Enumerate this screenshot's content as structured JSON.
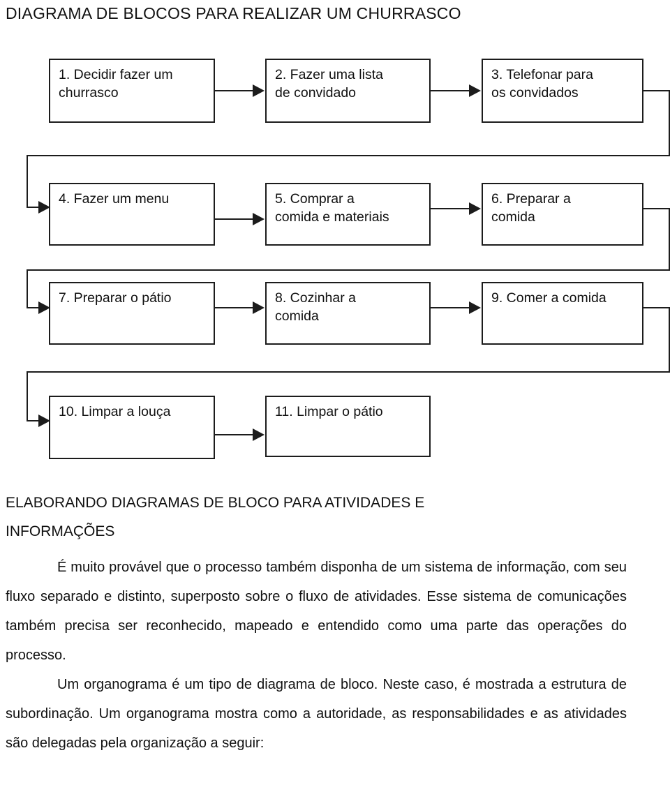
{
  "document": {
    "title": "DIAGRAMA DE BLOCOS PARA REALIZAR UM CHURRASCO"
  },
  "diagram": {
    "type": "block-flow-diagram",
    "orientation": "serpentine-left-to-right",
    "nodes": [
      {
        "id": 1,
        "label": "1. Decidir fazer um\nchurrasco",
        "row": 1,
        "col": 1
      },
      {
        "id": 2,
        "label": "2. Fazer uma lista\nde convidado",
        "row": 1,
        "col": 2
      },
      {
        "id": 3,
        "label": "3. Telefonar para\nos convidados",
        "row": 1,
        "col": 3
      },
      {
        "id": 4,
        "label": "4. Fazer um menu",
        "row": 2,
        "col": 1
      },
      {
        "id": 5,
        "label": "5. Comprar a\ncomida e materiais",
        "row": 2,
        "col": 2
      },
      {
        "id": 6,
        "label": "6. Preparar a\ncomida",
        "row": 2,
        "col": 3
      },
      {
        "id": 7,
        "label": "7. Preparar o pátio",
        "row": 3,
        "col": 1
      },
      {
        "id": 8,
        "label": "8. Cozinhar a\ncomida",
        "row": 3,
        "col": 2
      },
      {
        "id": 9,
        "label": "9. Comer a comida",
        "row": 3,
        "col": 3
      },
      {
        "id": 10,
        "label": "10. Limpar a louça",
        "row": 4,
        "col": 1
      },
      {
        "id": 11,
        "label": "11. Limpar o pátio",
        "row": 4,
        "col": 2
      }
    ],
    "edges": [
      {
        "from": 1,
        "to": 2,
        "kind": "straight"
      },
      {
        "from": 2,
        "to": 3,
        "kind": "straight"
      },
      {
        "from": 3,
        "to": 4,
        "kind": "wrap"
      },
      {
        "from": 4,
        "to": 5,
        "kind": "straight"
      },
      {
        "from": 5,
        "to": 6,
        "kind": "straight"
      },
      {
        "from": 6,
        "to": 7,
        "kind": "wrap"
      },
      {
        "from": 7,
        "to": 8,
        "kind": "straight"
      },
      {
        "from": 8,
        "to": 9,
        "kind": "straight"
      },
      {
        "from": 9,
        "to": 10,
        "kind": "wrap"
      },
      {
        "from": 10,
        "to": 11,
        "kind": "straight"
      }
    ],
    "line_color": "#1c1c1c"
  },
  "section": {
    "heading": "ELABORANDO DIAGRAMAS DE BLOCO PARA ATIVIDADES E INFORMAÇÕES",
    "paragraphs": [
      "É muito provável que o processo também disponha de um sistema de informação, com seu fluxo separado e distinto, superposto sobre o fluxo de atividades. Esse sistema de comunicações também precisa ser reconhecido, mapeado e entendido como uma parte das operações do processo.",
      "Um organograma é um tipo de diagrama de bloco. Neste caso, é mostrada a estrutura de subordinação. Um organograma mostra como a autoridade, as responsabilidades e as atividades são delegadas pela organização a seguir:"
    ]
  }
}
